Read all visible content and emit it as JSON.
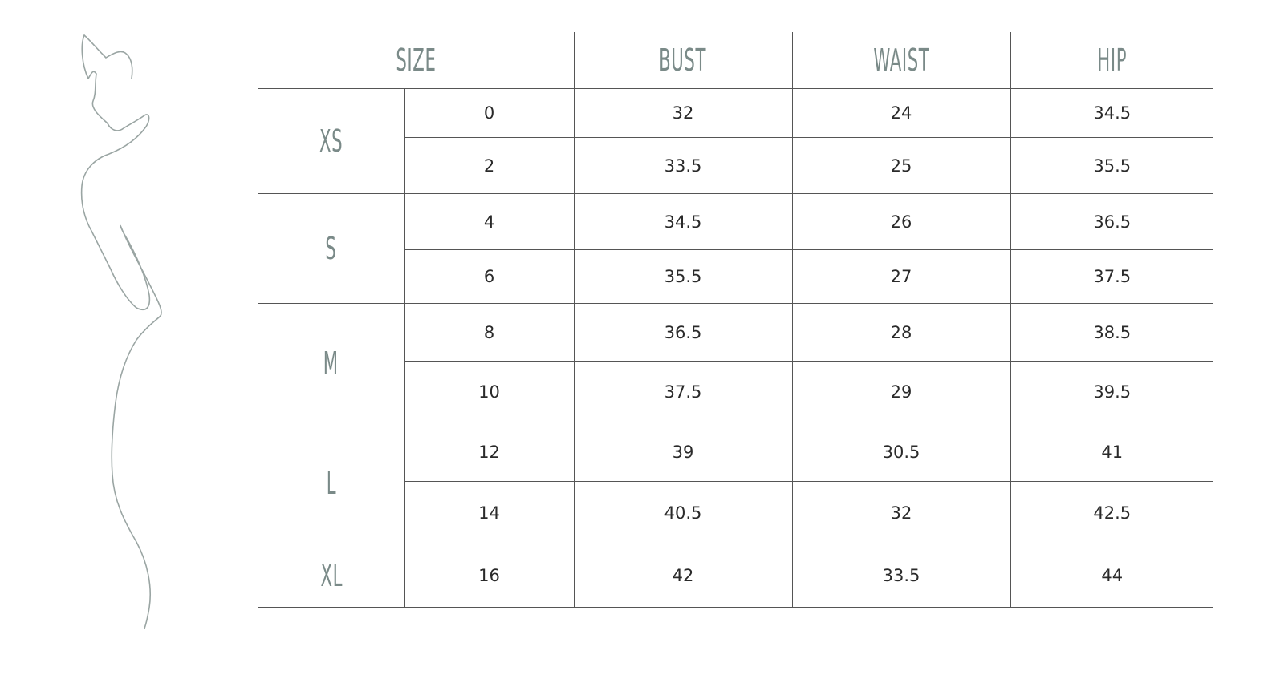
{
  "columns": {
    "size": "SIZE",
    "bust": "BUST",
    "waist": "WAIST",
    "hip": "HIP"
  },
  "groups": [
    {
      "label": "XS",
      "rows": [
        {
          "size": "0",
          "bust": "32",
          "waist": "24",
          "hip": "34.5"
        },
        {
          "size": "2",
          "bust": "33.5",
          "waist": "25",
          "hip": "35.5"
        }
      ]
    },
    {
      "label": "S",
      "rows": [
        {
          "size": "4",
          "bust": "34.5",
          "waist": "26",
          "hip": "36.5"
        },
        {
          "size": "6",
          "bust": "35.5",
          "waist": "27",
          "hip": "37.5"
        }
      ]
    },
    {
      "label": "M",
      "rows": [
        {
          "size": "8",
          "bust": "36.5",
          "waist": "28",
          "hip": "38.5"
        },
        {
          "size": "10",
          "bust": "37.5",
          "waist": "29",
          "hip": "39.5"
        }
      ]
    },
    {
      "label": "L",
      "rows": [
        {
          "size": "12",
          "bust": "39",
          "waist": "30.5",
          "hip": "41"
        },
        {
          "size": "14",
          "bust": "40.5",
          "waist": "32",
          "hip": "42.5"
        }
      ]
    },
    {
      "label": "XL",
      "rows": [
        {
          "size": "16",
          "bust": "42",
          "waist": "33.5",
          "hip": "44"
        }
      ]
    }
  ],
  "colors": {
    "header_text": "#7a8a88",
    "body_text": "#2a2a2a",
    "grid_line": "#555555",
    "figure_stroke": "#9aa5a3"
  },
  "illustration": "female-silhouette-line-drawing"
}
